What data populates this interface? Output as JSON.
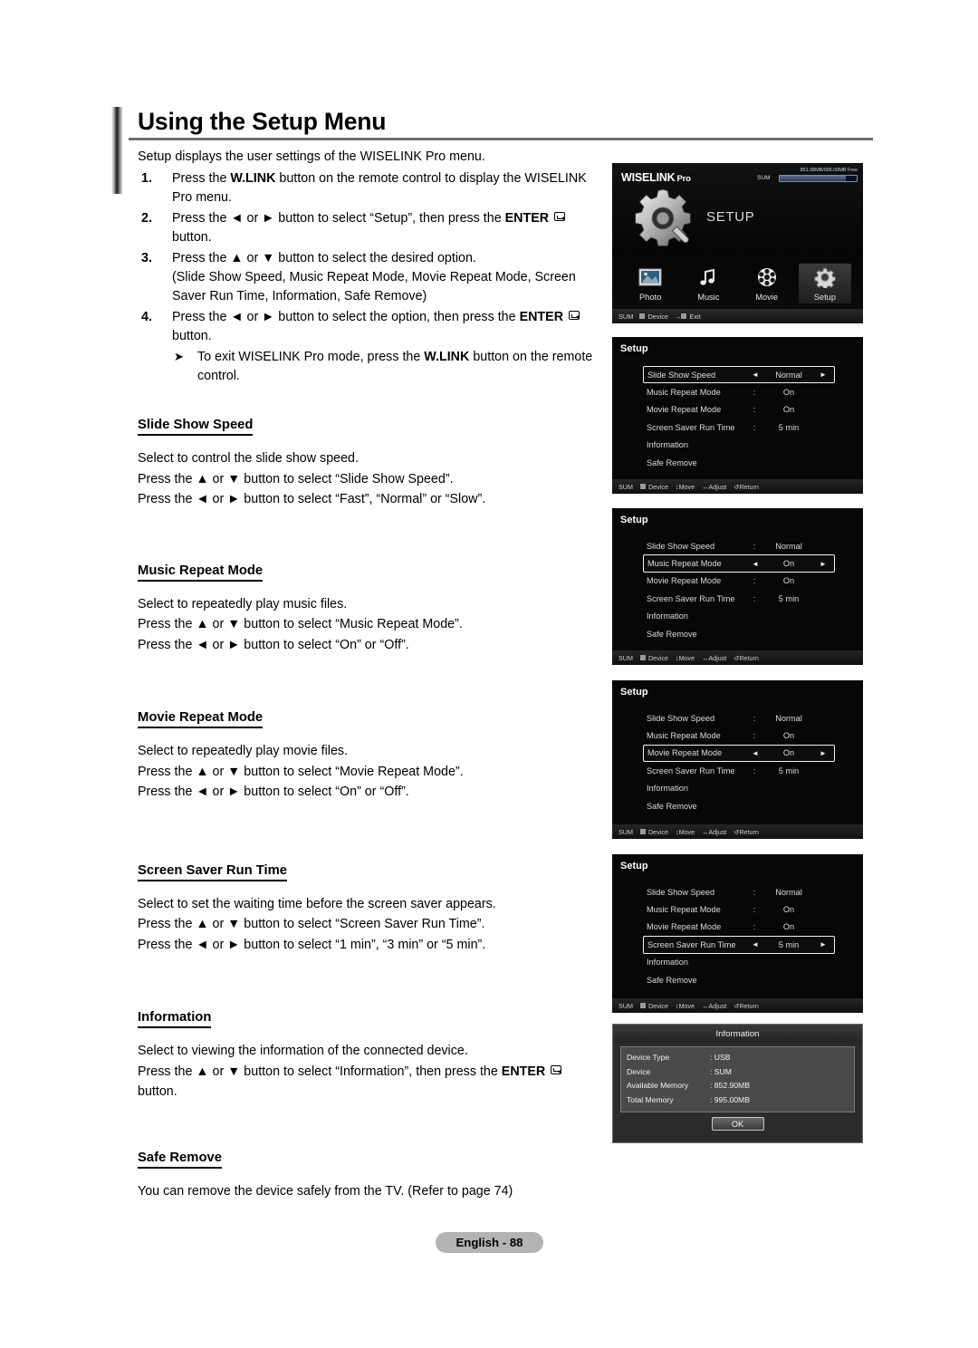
{
  "document": {
    "title": "Using the Setup Menu",
    "intro": "Setup displays the user settings of the WISELINK Pro menu.",
    "steps": [
      {
        "num": "1.",
        "html": "Press the <span class=\"b\">W.LINK</span> button on the remote control to display the WISELINK Pro menu."
      },
      {
        "num": "2.",
        "html": "Press the ◄ or ► button to select “Setup”, then press the <span class=\"b\">ENTER</span> <span class=\"enter-ico\" data-name=\"enter-icon\" data-interactable=\"false\"></span> button."
      },
      {
        "num": "3.",
        "html": "Press the ▲ or ▼ button to select the desired option.<br>(Slide Show Speed, Music Repeat Mode, Movie Repeat Mode, Screen Saver Run Time, Information, Safe Remove)"
      },
      {
        "num": "4.",
        "html": "Press the ◄ or ► button to select the option, then press the <span class=\"b\">ENTER</span> <span class=\"enter-ico\" data-name=\"enter-icon\" data-interactable=\"false\"></span> button."
      }
    ],
    "note": "To exit WISELINK Pro mode, press the <span class=\"b\">W.LINK</span> button on the remote control.",
    "sections": [
      {
        "heading": "Slide Show Speed",
        "lines": [
          "Select to control the slide show speed.",
          "Press the ▲ or ▼ button to select “Slide Show Speed”.",
          "Press the ◄ or ► button to select “Fast”, “Normal” or “Slow”."
        ]
      },
      {
        "heading": "Music Repeat Mode",
        "lines": [
          "Select to repeatedly play music files.",
          "Press the ▲ or ▼ button to select “Music Repeat Mode”.",
          "Press the ◄ or ► button to select “On” or “Off”."
        ]
      },
      {
        "heading": "Movie Repeat Mode",
        "lines": [
          "Select to repeatedly play movie files.",
          "Press the ▲ or ▼ button to select “Movie Repeat Mode”.",
          "Press the ◄ or ► button to select “On” or “Off”."
        ]
      },
      {
        "heading": "Screen Saver Run Time",
        "lines": [
          "Select to set the waiting time before the screen saver appears.",
          "Press the ▲ or ▼ button to select “Screen Saver Run Time”.",
          "Press the ◄ or ► button to select “1 min”, “3 min” or “5 min”."
        ]
      },
      {
        "heading": "Information",
        "lines": [
          "Select to viewing the information of the connected device.",
          "Press the ▲ or ▼ button to select “Information”, then press the <span class=\"b\">ENTER</span> <span class=\"enter-ico\" data-name=\"enter-icon\" data-interactable=\"false\"></span> button."
        ]
      },
      {
        "heading": "Safe Remove",
        "lines": [
          "You can remove the device safely from the TV. (Refer to page 74)"
        ]
      }
    ],
    "page_badge": "English - 88"
  },
  "wiselink_screen": {
    "brand": "WISELINK",
    "brand_sub": "Pro",
    "memory_text": "851.98MB/995.00MB Free",
    "sum_label": "SUM",
    "memory_used_percent": 86,
    "mode_label": "SETUP",
    "icons": [
      {
        "name": "photo-icon",
        "label": "Photo",
        "selected": false
      },
      {
        "name": "music-icon",
        "label": "Music",
        "selected": false
      },
      {
        "name": "movie-icon",
        "label": "Movie",
        "selected": false
      },
      {
        "name": "setup-gear-icon",
        "label": "Setup",
        "selected": true
      }
    ],
    "footer": {
      "sum": "SUM",
      "device": "Device",
      "exit": "Exit"
    }
  },
  "setup_screens": [
    {
      "title": "Setup",
      "active_index": 0,
      "rows": [
        {
          "label": "Slide Show Speed",
          "value": "Normal"
        },
        {
          "label": "Music Repeat Mode",
          "value": "On"
        },
        {
          "label": "Movie Repeat Mode",
          "value": "On"
        },
        {
          "label": "Screen Saver Run Time",
          "value": "5 min"
        },
        {
          "label": "Information",
          "value": ""
        },
        {
          "label": "Safe Remove",
          "value": ""
        }
      ]
    },
    {
      "title": "Setup",
      "active_index": 1,
      "rows": [
        {
          "label": "Slide Show Speed",
          "value": "Normal"
        },
        {
          "label": "Music Repeat Mode",
          "value": "On"
        },
        {
          "label": "Movie Repeat Mode",
          "value": "On"
        },
        {
          "label": "Screen Saver Run Time",
          "value": "5 min"
        },
        {
          "label": "Information",
          "value": ""
        },
        {
          "label": "Safe Remove",
          "value": ""
        }
      ]
    },
    {
      "title": "Setup",
      "active_index": 2,
      "rows": [
        {
          "label": "Slide Show Speed",
          "value": "Normal"
        },
        {
          "label": "Music Repeat Mode",
          "value": "On"
        },
        {
          "label": "Movie Repeat Mode",
          "value": "On"
        },
        {
          "label": "Screen Saver Run Time",
          "value": "5 min"
        },
        {
          "label": "Information",
          "value": ""
        },
        {
          "label": "Safe Remove",
          "value": ""
        }
      ]
    },
    {
      "title": "Setup",
      "active_index": 3,
      "rows": [
        {
          "label": "Slide Show Speed",
          "value": "Normal"
        },
        {
          "label": "Music Repeat Mode",
          "value": "On"
        },
        {
          "label": "Movie Repeat Mode",
          "value": "On"
        },
        {
          "label": "Screen Saver Run Time",
          "value": "5 min"
        },
        {
          "label": "Information",
          "value": ""
        },
        {
          "label": "Safe Remove",
          "value": ""
        }
      ]
    }
  ],
  "setup_footer": {
    "sum": "SUM",
    "device": "Device",
    "move": "Move",
    "adjust": "Adjust",
    "return": "Return"
  },
  "information_dialog": {
    "title": "Information",
    "rows": [
      {
        "key": "Device Type",
        "value": ": USB"
      },
      {
        "key": "Device",
        "value": ": SUM"
      },
      {
        "key": "Available Memory",
        "value": ": 852.90MB"
      },
      {
        "key": "Total Memory",
        "value": ": 995.00MB"
      }
    ],
    "ok_label": "OK"
  },
  "colors": {
    "screen_background": "#070707",
    "highlight_border": "#f2f2f2",
    "page_badge": "#b3b3b3",
    "title_rule": "#6f6f6f"
  }
}
